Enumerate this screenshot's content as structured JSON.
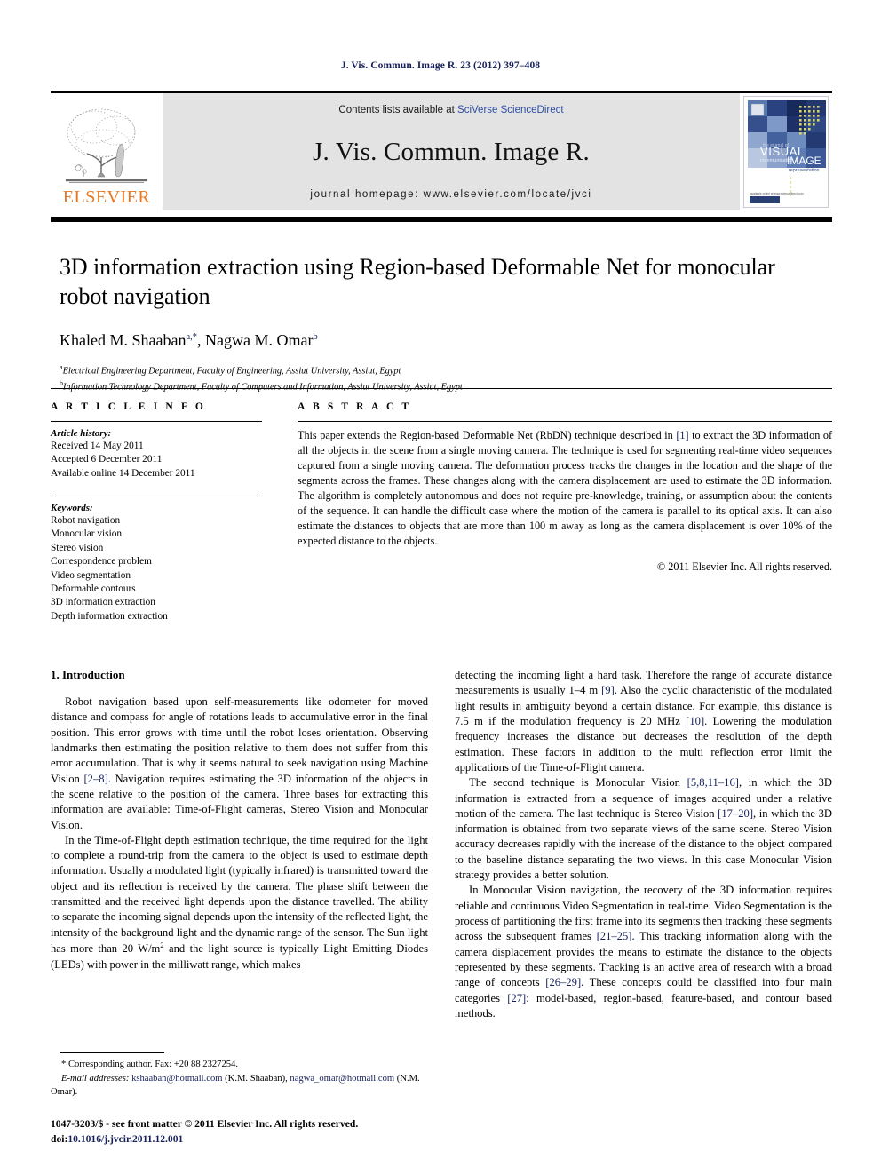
{
  "running_head": "J. Vis. Commun. Image R. 23 (2012) 397–408",
  "banner": {
    "contents_prefix": "Contents lists available at ",
    "contents_link": "SciVerse ScienceDirect",
    "journal_title": "J. Vis. Commun. Image R.",
    "homepage": "journal homepage: www.elsevier.com/locate/jvci",
    "publisher_wordmark": "ELSEVIER",
    "publisher_color": "#e87722",
    "link_color": "#2a4fa2",
    "cover": {
      "line1": "VISUAL",
      "line2": "communication &",
      "line3": "IMAGE",
      "line4": "representation"
    }
  },
  "article": {
    "title": "3D information extraction using Region-based Deformable Net for monocular robot navigation",
    "authors": "Khaled M. Shaaban",
    "author_sup_1": "a,*",
    "authors_2": ", Nagwa M. Omar",
    "author_sup_2": "b",
    "affiliation_a_sup": "a",
    "affiliation_a": "Electrical Engineering Department, Faculty of Engineering, Assiut University, Assiut, Egypt",
    "affiliation_b_sup": "b",
    "affiliation_b": "Information Technology Department, Faculty of Computers and Information, Assiut University, Assiut, Egypt"
  },
  "info": {
    "heading": "A R T I C L E    I N F O",
    "history_label": "Article history:",
    "history": [
      "Received 14 May 2011",
      "Accepted 6 December 2011",
      "Available online 14 December 2011"
    ],
    "keywords_label": "Keywords:",
    "keywords": [
      "Robot navigation",
      "Monocular vision",
      "Stereo vision",
      "Correspondence problem",
      "Video segmentation",
      "Deformable contours",
      "3D information extraction",
      "Depth information extraction"
    ]
  },
  "abstract": {
    "heading": "A B S T R A C T",
    "part1": "This paper extends the Region-based Deformable Net (RbDN) technique described in ",
    "ref1": "[1]",
    "part2": " to extract the 3D information of all the objects in the scene from a single moving camera. The technique is used for segmenting real-time video sequences captured from a single moving camera. The deformation process tracks the changes in the location and the shape of the segments across the frames. These changes along with the camera displacement are used to estimate the 3D information. The algorithm is completely autonomous and does not require pre-knowledge, training, or assumption about the contents of the sequence. It can handle the difficult case where the motion of the camera is parallel to its optical axis. It can also estimate the distances to objects that are more than 100 m away as long as the camera displacement is over 10% of the expected distance to the objects.",
    "copyright": "© 2011 Elsevier Inc. All rights reserved."
  },
  "body": {
    "section_heading": "1. Introduction",
    "left": {
      "p1_a": "Robot navigation based upon self-measurements like odometer for moved distance and compass for angle of rotations leads to accumulative error in the final position. This error grows with time until the robot loses orientation. Observing landmarks then estimating the position relative to them does not suffer from this error accumulation. That is why it seems natural to seek navigation using Machine Vision ",
      "p1_ref": "[2–8]",
      "p1_b": ". Navigation requires estimating the 3D information of the objects in the scene relative to the position of the camera. Three bases for extracting this information are available: Time-of-Flight cameras, Stereo Vision and Monocular Vision.",
      "p2_a": "In the Time-of-Flight depth estimation technique, the time required for the light to complete a round-trip from the camera to the object is used to estimate depth information. Usually a modulated light (typically infrared) is transmitted toward the object and its reflection is received by the camera. The phase shift between the transmitted and the received light depends upon the distance travelled. The ability to separate the incoming signal depends upon the intensity of the reflected light, the intensity of the background light and the dynamic range of the sensor. The Sun light has more than 20 W/m",
      "p2_sup": "2",
      "p2_b": " and the light source is typically Light Emitting Diodes (LEDs) with power in the milliwatt range, which makes"
    },
    "right": {
      "p1": "detecting the incoming light a hard task. Therefore the range of accurate distance measurements is usually 1–4 m ",
      "p1_ref": "[9]",
      "p1_b": ". Also the cyclic characteristic of the modulated light results in ambiguity beyond a certain distance. For example, this distance is 7.5 m if the modulation frequency is 20 MHz ",
      "p1_ref2": "[10]",
      "p1_c": ". Lowering the modulation frequency increases the distance but decreases the resolution of the depth estimation. These factors in addition to the multi reflection error limit the applications of the Time-of-Flight camera.",
      "p2_a": "The second technique is Monocular Vision ",
      "p2_ref": "[5,8,11–16]",
      "p2_b": ", in which the 3D information is extracted from a sequence of images acquired under a relative motion of the camera. The last technique is Stereo Vision ",
      "p2_ref2": "[17–20]",
      "p2_c": ", in which the 3D information is obtained from two separate views of the same scene. Stereo Vision accuracy decreases rapidly with the increase of the distance to the object compared to the baseline distance separating the two views. In this case Monocular Vision strategy provides a better solution.",
      "p3_a": "In Monocular Vision navigation, the recovery of the 3D information requires reliable and continuous Video Segmentation in real-time. Video Segmentation is the process of partitioning the first frame into its segments then tracking these segments across the subsequent frames ",
      "p3_ref": "[21–25]",
      "p3_b": ". This tracking information along with the camera displacement provides the means to estimate the distance to the objects represented by these segments. Tracking is an active area of research with a broad range of concepts ",
      "p3_ref2": "[26–29]",
      "p3_c": ". These concepts could be classified into four main categories ",
      "p3_ref3": "[27]",
      "p3_d": ": model-based, region-based, feature-based, and contour based methods."
    }
  },
  "footnotes": {
    "corresponding": "* Corresponding author. Fax: +20 88 2327254.",
    "email_label": "E-mail addresses:",
    "email1": "kshaaban@hotmail.com",
    "email1_name": " (K.M. Shaaban), ",
    "email2": "nagwa_omar@hotmail.com",
    "email2_name": " (N.M. Omar)."
  },
  "page_footer": {
    "line1": "1047-3203/$ - see front matter © 2011 Elsevier Inc. All rights reserved.",
    "doi_label": "doi:",
    "doi_value": "10.1016/j.jvcir.2011.12.001"
  }
}
